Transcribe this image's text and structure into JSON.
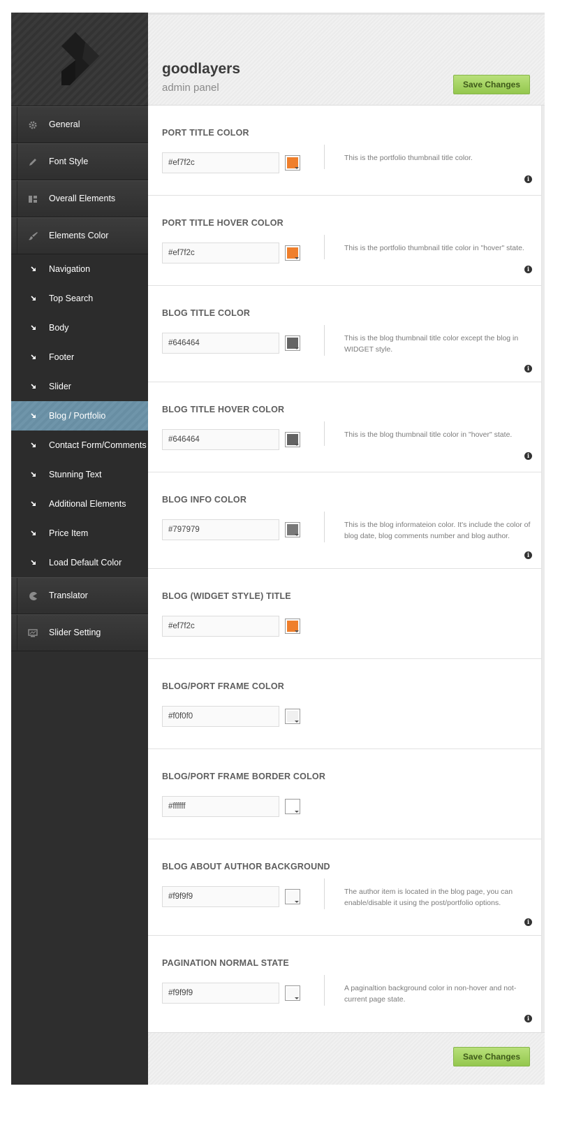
{
  "header": {
    "brand_title": "goodlayers",
    "brand_subtitle": "admin panel",
    "save_label": "Save Changes"
  },
  "footer": {
    "save_label": "Save Changes"
  },
  "sidebar": {
    "logo_icon": "goodlayers-logo-icon",
    "main_top": [
      {
        "label": "General",
        "icon": "gear-icon"
      },
      {
        "label": "Font Style",
        "icon": "pencil-icon"
      },
      {
        "label": "Overall Elements",
        "icon": "layout-icon"
      },
      {
        "label": "Elements Color",
        "icon": "brush-icon"
      }
    ],
    "sub_items": [
      {
        "label": "Navigation",
        "active": false
      },
      {
        "label": "Top Search",
        "active": false
      },
      {
        "label": "Body",
        "active": false
      },
      {
        "label": "Footer",
        "active": false
      },
      {
        "label": "Slider",
        "active": false
      },
      {
        "label": "Blog / Portfolio",
        "active": true
      },
      {
        "label": "Contact Form/Comments",
        "active": false
      },
      {
        "label": "Stunning Text",
        "active": false
      },
      {
        "label": "Additional Elements",
        "active": false
      },
      {
        "label": "Price Item",
        "active": false
      },
      {
        "label": "Load Default Color",
        "active": false
      }
    ],
    "main_bottom": [
      {
        "label": "Translator",
        "icon": "pacman-icon"
      },
      {
        "label": "Slider Setting",
        "icon": "monitor-icon"
      }
    ]
  },
  "colors": {
    "sidebar_bg": "#2e2e2e",
    "active_item": "#6f95aa",
    "save_button": "#a6d465"
  },
  "sections": [
    {
      "title": "PORT TITLE COLOR",
      "value": "#ef7f2c",
      "swatch": "#ef7f2c",
      "desc": "This is the portfolio thumbnail title color."
    },
    {
      "title": "PORT TITLE HOVER COLOR",
      "value": "#ef7f2c",
      "swatch": "#ef7f2c",
      "desc": "This is the portfolio thumbnail title color in \"hover\" state."
    },
    {
      "title": "BLOG TITLE COLOR",
      "value": "#646464",
      "swatch": "#646464",
      "desc": "This is the blog thumbnail title color except the blog in WIDGET style."
    },
    {
      "title": "BLOG TITLE HOVER COLOR",
      "value": "#646464",
      "swatch": "#646464",
      "desc": "This is the blog thumbnail title color in \"hover\" state."
    },
    {
      "title": "BLOG INFO COLOR",
      "value": "#797979",
      "swatch": "#797979",
      "desc": "This is the blog informateion color. It's include the color of blog date, blog comments number and blog author."
    },
    {
      "title": "BLOG (WIDGET STYLE) TITLE",
      "value": "#ef7f2c",
      "swatch": "#ef7f2c",
      "desc": ""
    },
    {
      "title": "BLOG/PORT FRAME COLOR",
      "value": "#f0f0f0",
      "swatch": "#f0f0f0",
      "desc": ""
    },
    {
      "title": "BLOG/PORT FRAME BORDER COLOR",
      "value": "#ffffff",
      "swatch": "#ffffff",
      "desc": ""
    },
    {
      "title": "BLOG ABOUT AUTHOR BACKGROUND",
      "value": "#f9f9f9",
      "swatch": "#f9f9f9",
      "desc": "The author item is located in the blog page, you can enable/disable it using the post/portfolio options."
    },
    {
      "title": "PAGINATION NORMAL STATE",
      "value": "#f9f9f9",
      "swatch": "#f9f9f9",
      "desc": "A paginaltion background color in non-hover and not-current page state."
    }
  ]
}
